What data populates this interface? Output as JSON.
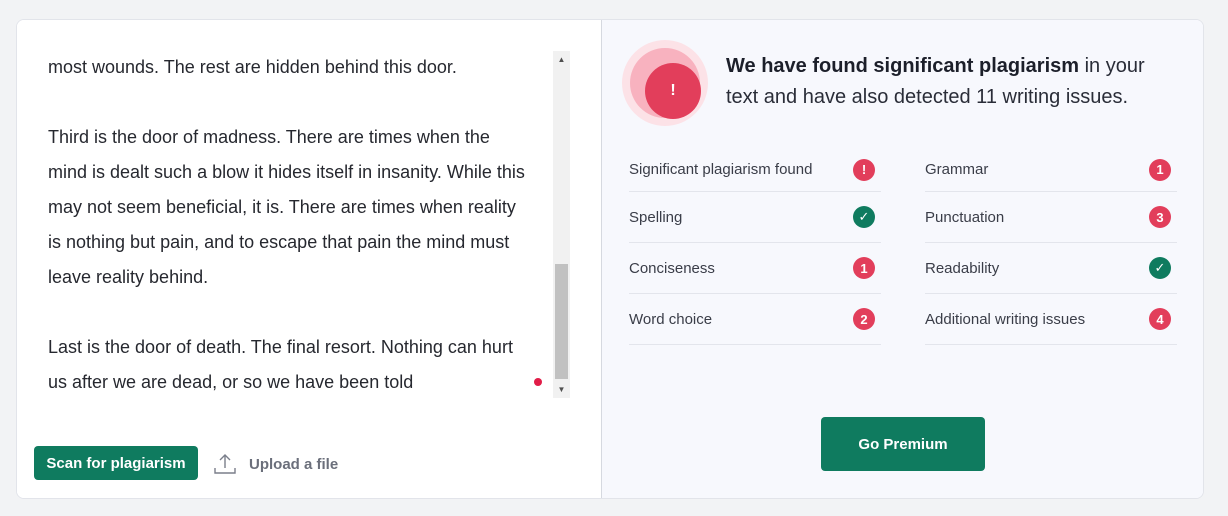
{
  "editor": {
    "paragraphs": [
      [
        "most wounds. The rest are hidden behind this door."
      ],
      [
        "Third is the door of madness. There are times when the",
        "mind is dealt such a blow it hides itself in insanity. While this",
        "may not seem beneficial, it is. There are times when reality",
        "is nothing but pain, and to escape that pain the mind must",
        "leave reality behind."
      ],
      [
        "Last is the door of death. The final resort. Nothing can hurt",
        "us after we are dead, or so we have been told"
      ]
    ]
  },
  "actions": {
    "scan_label": "Scan for plagiarism",
    "upload_label": "Upload a file",
    "upload_icon": "upload-icon"
  },
  "result": {
    "alert_icon": "!",
    "headline_bold": "We have found significant plagiarism",
    "headline_rest": " in your text and have also detected 11 writing issues.",
    "colors": {
      "danger": "#e23e5b",
      "success": "#0f7b5f"
    },
    "issues_left": [
      {
        "label": "Significant plagiarism found",
        "badge": "!",
        "status": "red"
      },
      {
        "label": "Spelling",
        "badge": "✓",
        "status": "green"
      },
      {
        "label": "Conciseness",
        "badge": "1",
        "status": "red"
      },
      {
        "label": "Word choice",
        "badge": "2",
        "status": "red"
      }
    ],
    "issues_right": [
      {
        "label": "Grammar",
        "badge": "1",
        "status": "red"
      },
      {
        "label": "Punctuation",
        "badge": "3",
        "status": "red"
      },
      {
        "label": "Readability",
        "badge": "✓",
        "status": "green"
      },
      {
        "label": "Additional writing issues",
        "badge": "4",
        "status": "red"
      }
    ],
    "premium_label": "Go Premium"
  }
}
